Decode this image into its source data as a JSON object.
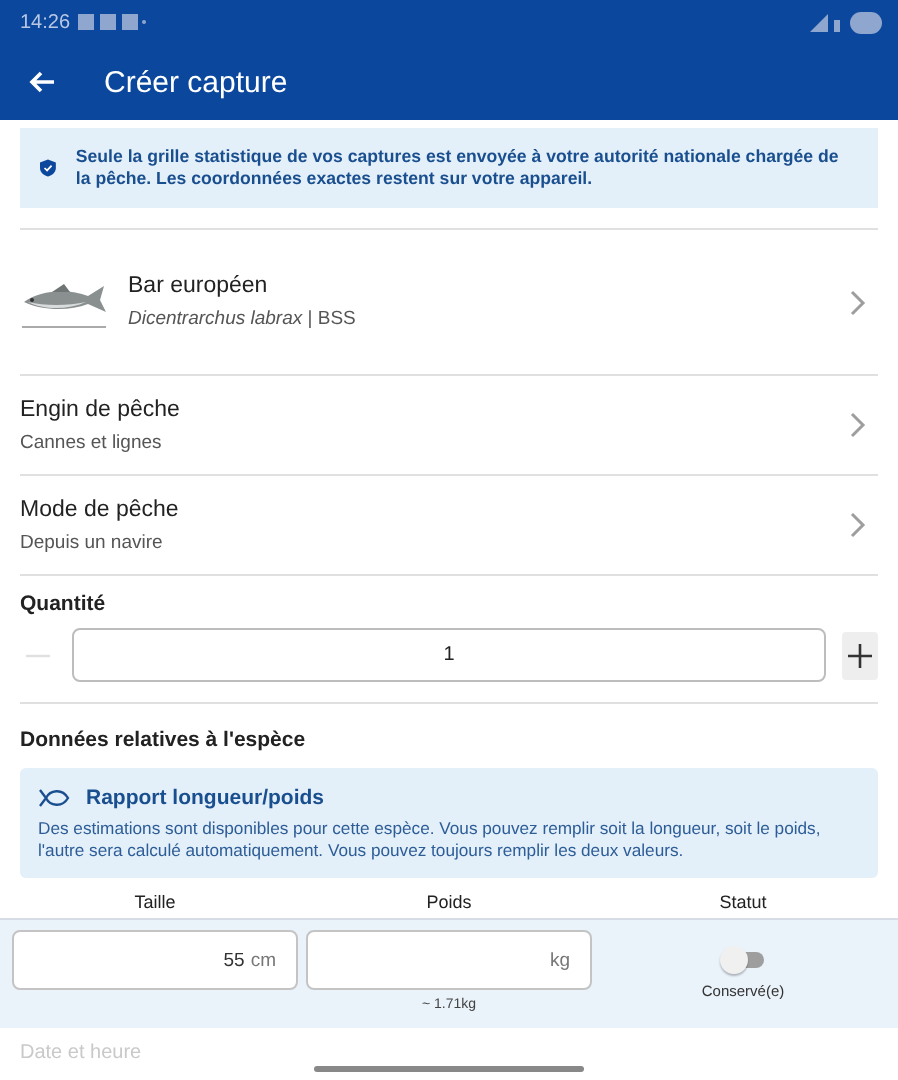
{
  "status_bar": {
    "time": "14:26"
  },
  "app_bar": {
    "title": "Créer capture"
  },
  "privacy_notice": {
    "text": "Seule la grille statistique de vos captures est envoyée à votre autorité nationale chargée de la pêche. Les coordonnées exactes restent sur votre appareil."
  },
  "species": {
    "kind": "picture",
    "name": "Bar européen",
    "subtitle": "*Dicentrarchus labrax* | BSS"
  },
  "selectors": [
    {
      "label": "Engin de pêche",
      "value": "Cannes et lignes"
    },
    {
      "label": "Mode de pêche",
      "value": "Depuis un navire"
    }
  ],
  "quantity": {
    "label": "Quantité",
    "value": "1",
    "decrement_disabled": true
  },
  "species_data": {
    "title": "Données relatives à l'espèce",
    "card": {
      "title": "Rapport longueur/poids",
      "text": "Des estimations sont disponibles pour cette espèce. Vous pouvez remplir soit la longueur, soit le poids, l'autre sera calculé automatiquement. Vous pouvez toujours remplir les deux valeurs."
    },
    "columns": [
      "Taille",
      "Poids",
      "Statut"
    ],
    "size": {
      "value": "55",
      "unit": "cm"
    },
    "weight": {
      "unit": "kg",
      "estimate": "~ 1.71kg"
    },
    "status": {
      "label": "Conservé(e)",
      "on": false
    }
  },
  "next_section": {
    "title": "Date et heure"
  }
}
